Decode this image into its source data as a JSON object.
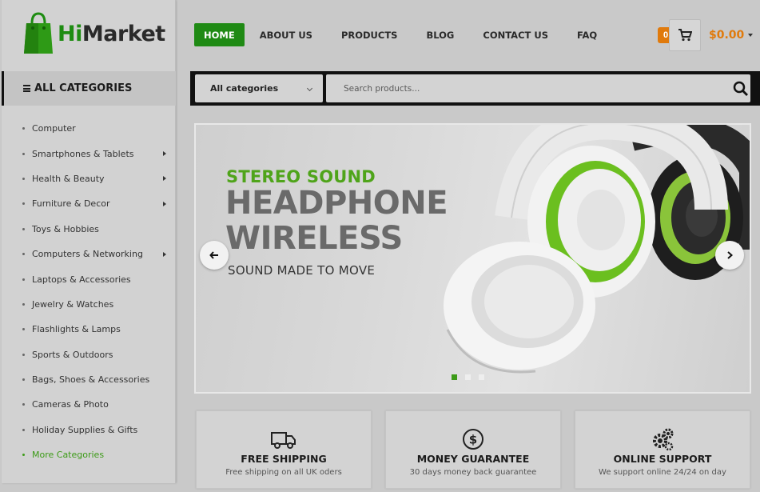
{
  "brand": {
    "prefix": "Hi",
    "suffix": "Market"
  },
  "nav": [
    {
      "label": "HOME",
      "active": true
    },
    {
      "label": "ABOUT US"
    },
    {
      "label": "PRODUCTS"
    },
    {
      "label": "BLOG"
    },
    {
      "label": "CONTACT US"
    },
    {
      "label": "FAQ"
    }
  ],
  "cart": {
    "count": "0",
    "total": "$0.00"
  },
  "categories": {
    "header": "ALL CATEGORIES",
    "items": [
      {
        "label": "Computer",
        "has_sub": false
      },
      {
        "label": "Smartphones & Tablets",
        "has_sub": true
      },
      {
        "label": "Health & Beauty",
        "has_sub": true
      },
      {
        "label": "Furniture & Decor",
        "has_sub": true
      },
      {
        "label": "Toys & Hobbies",
        "has_sub": false
      },
      {
        "label": "Computers & Networking",
        "has_sub": true
      },
      {
        "label": "Laptops & Accessories",
        "has_sub": false
      },
      {
        "label": "Jewelry & Watches",
        "has_sub": false
      },
      {
        "label": "Flashlights & Lamps",
        "has_sub": false
      },
      {
        "label": "Sports & Outdoors",
        "has_sub": false
      },
      {
        "label": "Bags, Shoes & Accessories",
        "has_sub": false
      },
      {
        "label": "Cameras & Photo",
        "has_sub": false
      },
      {
        "label": "Holiday Supplies & Gifts",
        "has_sub": false
      },
      {
        "label": "More Categories",
        "has_sub": false,
        "more": true
      }
    ]
  },
  "search": {
    "category": "All categories",
    "placeholder": "Search products..."
  },
  "hero": {
    "subtitle": "STEREO SOUND",
    "title": "HEADPHONE WIRELESS",
    "tagline": "SOUND MADE TO MOVE"
  },
  "features": [
    {
      "icon": "truck-icon",
      "title": "FREE SHIPPING",
      "desc": "Free shipping on all UK oders"
    },
    {
      "icon": "dollar-icon",
      "title": "MONEY GUARANTEE",
      "desc": "30 days money back guarantee"
    },
    {
      "icon": "gears-icon",
      "title": "ONLINE SUPPORT",
      "desc": "We support online 24/24 on day"
    }
  ],
  "colors": {
    "accent": "#1f8a14",
    "price": "#e07a0c",
    "hero_sub": "#4fa41a"
  }
}
